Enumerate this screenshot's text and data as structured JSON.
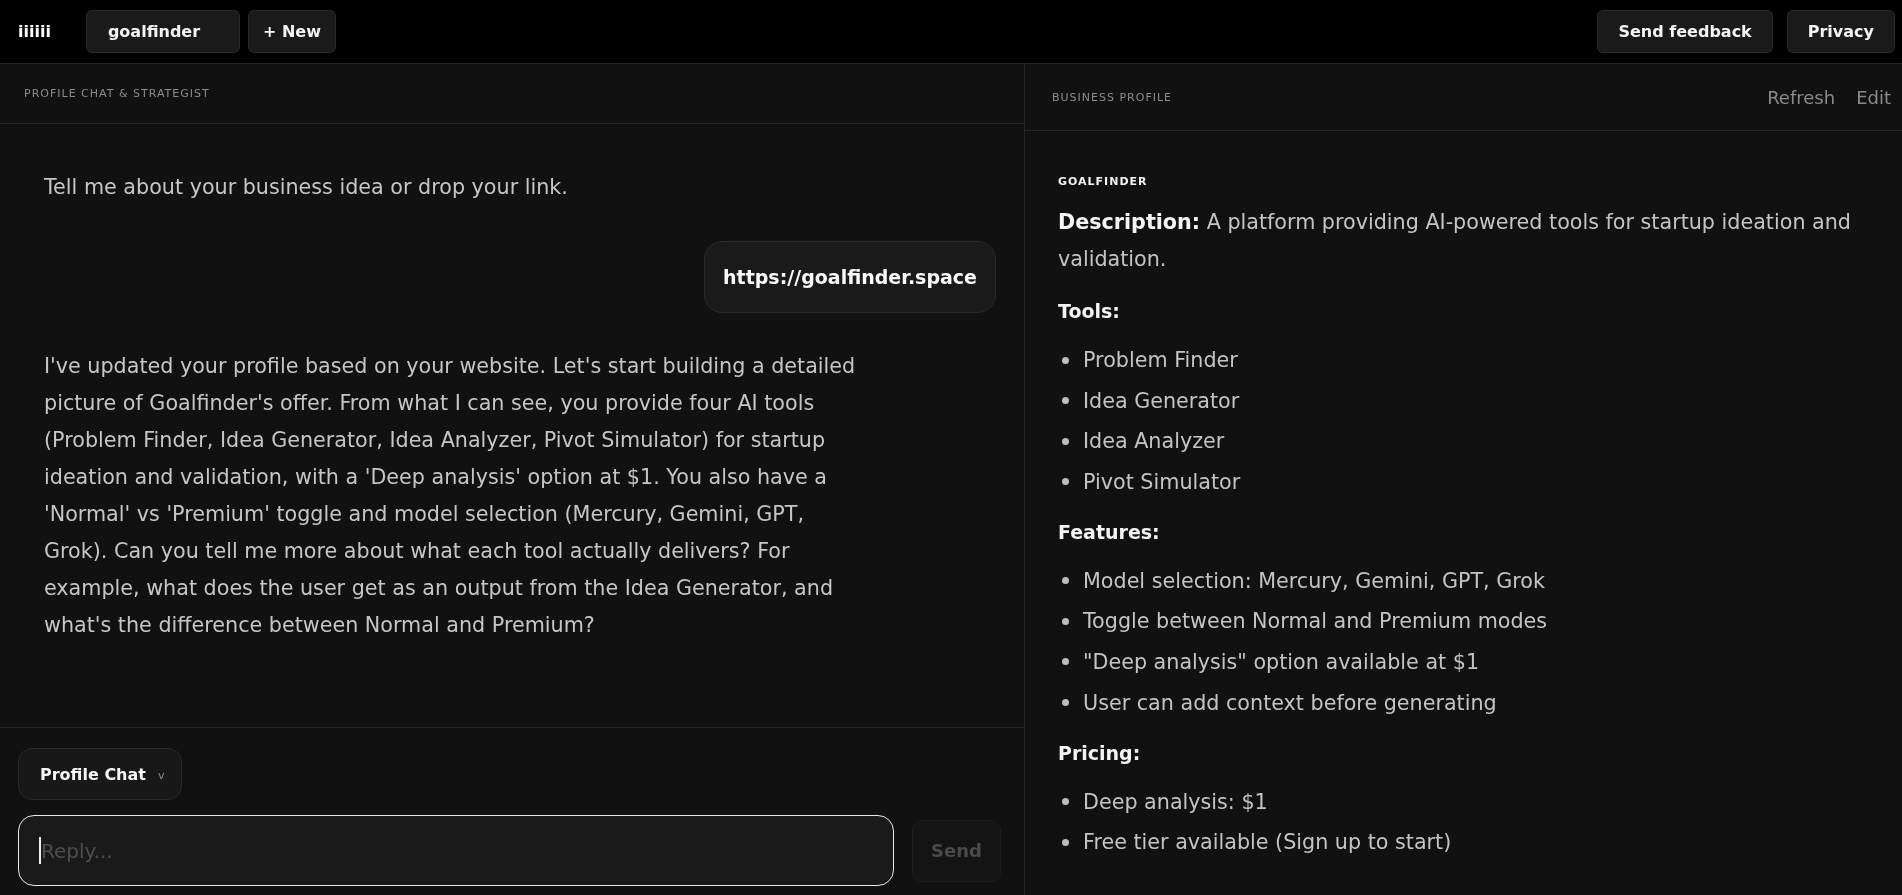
{
  "top_bar": {
    "logo": "iiiiii",
    "project_field": {
      "value": "goalfinder"
    },
    "new_button": "+ New",
    "actions": [
      "Send feedback",
      "Privacy"
    ]
  },
  "chat_panel": {
    "title": "PROFILE CHAT & STRATEGIST",
    "messages": [
      {
        "kind": "assistant",
        "text": "Tell me about your business idea or drop your link."
      },
      {
        "kind": "user",
        "text": "https://goalfinder.space"
      },
      {
        "kind": "assistant",
        "text": "I've updated your profile based on your website. Let's start building a detailed picture of Goalfinder's offer. From what I can see, you provide four AI tools (Problem Finder, Idea Generator, Idea Analyzer, Pivot Simulator) for startup ideation and validation, with a 'Deep analysis' option at $1. You also have a 'Normal' vs 'Premium' toggle and model selection (Mercury, Gemini, GPT, Grok). Can you tell me more about what each tool actually delivers? For example, what does the user get as an output from the Idea Generator, and what's the difference between Normal and Premium?"
      }
    ],
    "mode_dropdown": {
      "label": "Profile Chat",
      "indicator": "v"
    },
    "reply_field": {
      "placeholder": "Reply...",
      "focused": true
    },
    "send_button": {
      "label": "Send",
      "disabled": true
    }
  },
  "profile_panel": {
    "title": "BUSINESS PROFILE",
    "actions": [
      "Refresh",
      "Edit"
    ],
    "name": "GOALFINDER",
    "description": "**Description:** A platform providing AI-powered tools for startup ideation and validation.",
    "sections": [
      {
        "heading": "Tools:",
        "items": [
          "Problem Finder",
          "Idea Generator",
          "Idea Analyzer",
          "Pivot Simulator"
        ]
      },
      {
        "heading": "Features:",
        "items": [
          "Model selection: Mercury, Gemini, GPT, Grok",
          "Toggle between Normal and Premium modes",
          "\"Deep analysis\" option available at $1",
          "User can add context before generating"
        ]
      },
      {
        "heading": "Pricing:",
        "items": [
          "Deep analysis: $1",
          "Free tier available (Sign up to start)"
        ]
      }
    ]
  }
}
